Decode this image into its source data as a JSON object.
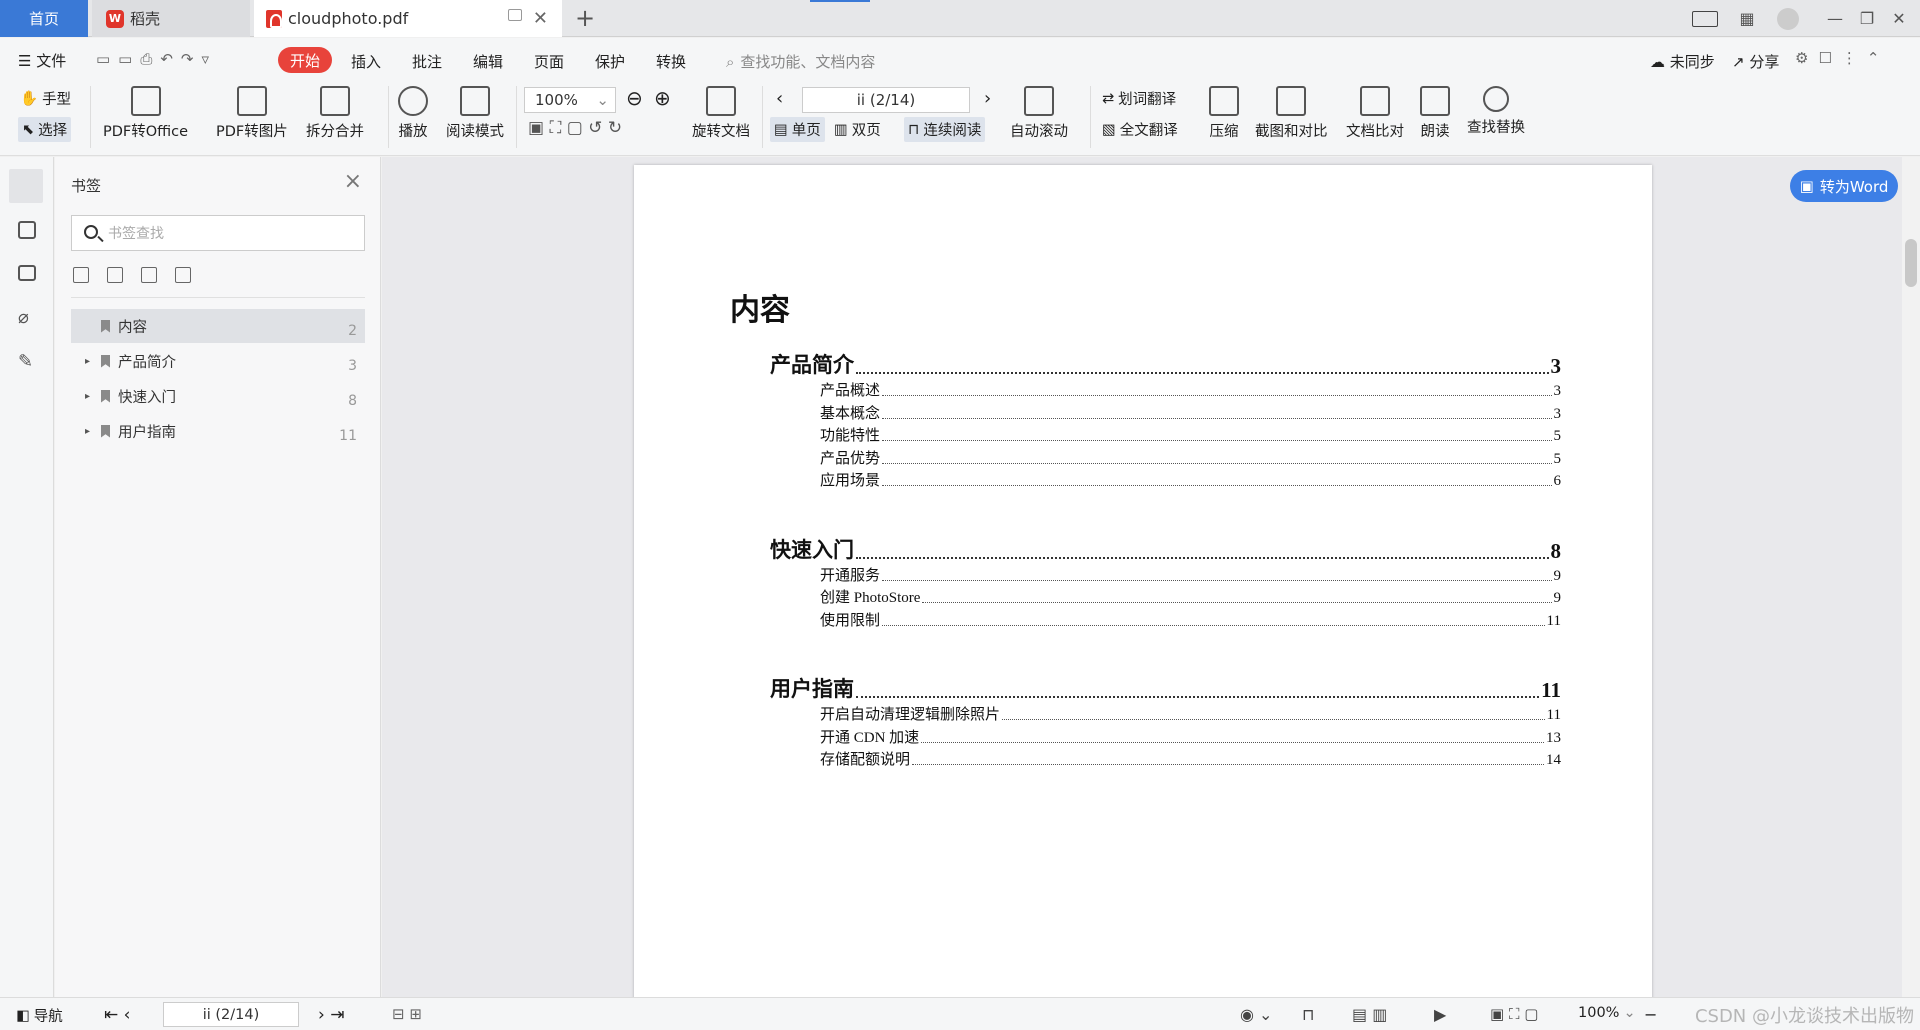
{
  "tabs": {
    "home": "首页",
    "daoke": "稻壳",
    "file": "cloudphoto.pdf"
  },
  "menu": {
    "file": "文件",
    "start": "开始",
    "insert": "插入",
    "annotate": "批注",
    "edit": "编辑",
    "page": "页面",
    "protect": "保护",
    "convert": "转换",
    "search_placeholder": "查找功能、文档内容",
    "unsynced": "未同步",
    "share": "分享"
  },
  "toolbar": {
    "hand": "手型",
    "select": "选择",
    "pdf_to_office": "PDF转Office",
    "pdf_to_image": "PDF转图片",
    "split_merge": "拆分合并",
    "play": "播放",
    "read_mode": "阅读模式",
    "zoom": "100%",
    "rotate_doc": "旋转文档",
    "page_indicator": "ii (2/14)",
    "single_page": "单页",
    "double_page": "双页",
    "continuous": "连续阅读",
    "auto_scroll": "自动滚动",
    "word_translate": "划词翻译",
    "full_translate": "全文翻译",
    "compress": "压缩",
    "screenshot_compare": "截图和对比",
    "doc_compare": "文档比对",
    "read_aloud": "朗读",
    "find_replace": "查找替换"
  },
  "bookmarks": {
    "title": "书签",
    "search_placeholder": "书签查找",
    "items": [
      {
        "label": "内容",
        "page": "2",
        "expandable": false
      },
      {
        "label": "产品简介",
        "page": "3",
        "expandable": true
      },
      {
        "label": "快速入门",
        "page": "8",
        "expandable": true
      },
      {
        "label": "用户指南",
        "page": "11",
        "expandable": true
      }
    ]
  },
  "convert_word": "转为Word",
  "document": {
    "title": "内容",
    "sections": [
      {
        "title": "产品简介",
        "page": "3",
        "entries": [
          {
            "title": "产品概述",
            "page": "3"
          },
          {
            "title": "基本概念",
            "page": "3"
          },
          {
            "title": "功能特性",
            "page": "5"
          },
          {
            "title": "产品优势",
            "page": "5"
          },
          {
            "title": "应用场景",
            "page": "6"
          }
        ]
      },
      {
        "title": "快速入门",
        "page": "8",
        "entries": [
          {
            "title": "开通服务",
            "page": "9"
          },
          {
            "title": "创建 PhotoStore",
            "page": "9"
          },
          {
            "title": "使用限制",
            "page": "11"
          }
        ]
      },
      {
        "title": "用户指南",
        "page": "11",
        "entries": [
          {
            "title": "开启自动清理逻辑删除照片",
            "page": "11"
          },
          {
            "title": "开通 CDN 加速",
            "page": "13"
          },
          {
            "title": "存储配额说明",
            "page": "14"
          }
        ]
      }
    ]
  },
  "statusbar": {
    "nav": "导航",
    "page": "ii (2/14)",
    "zoom": "100%",
    "watermark": "CSDN @小龙谈技术出版物"
  }
}
